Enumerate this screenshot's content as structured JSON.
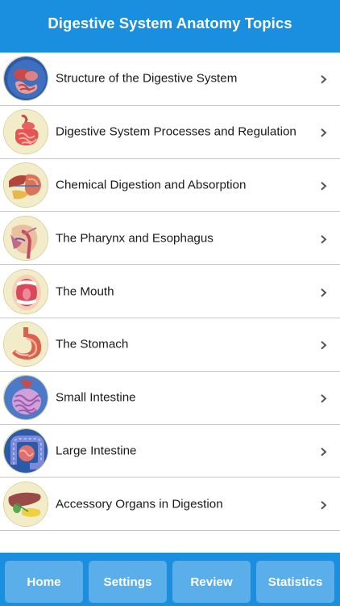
{
  "header": {
    "title": "Digestive System Anatomy Topics"
  },
  "topics": [
    {
      "label": "Structure of the Digestive System",
      "icon": "digestive-system-icon"
    },
    {
      "label": "Digestive System Processes and Regulation",
      "icon": "intestines-icon"
    },
    {
      "label": "Chemical Digestion and Absorption",
      "icon": "stomach-pancreas-icon"
    },
    {
      "label": "The Pharynx and Esophagus",
      "icon": "pharynx-icon"
    },
    {
      "label": "The Mouth",
      "icon": "mouth-icon"
    },
    {
      "label": "The Stomach",
      "icon": "stomach-icon"
    },
    {
      "label": "Small Intestine",
      "icon": "small-intestine-icon"
    },
    {
      "label": "Large Intestine",
      "icon": "large-intestine-icon"
    },
    {
      "label": "Accessory Organs in Digestion",
      "icon": "liver-gallbladder-icon"
    }
  ],
  "tabs": {
    "home": "Home",
    "settings": "Settings",
    "review": "Review",
    "statistics": "Statistics"
  },
  "colors": {
    "header_bg": "#1a8fe0",
    "tab_button_bg": "#5aaeea",
    "thumb_bg": "#f3ecc8",
    "divider": "#c8c8c8"
  }
}
